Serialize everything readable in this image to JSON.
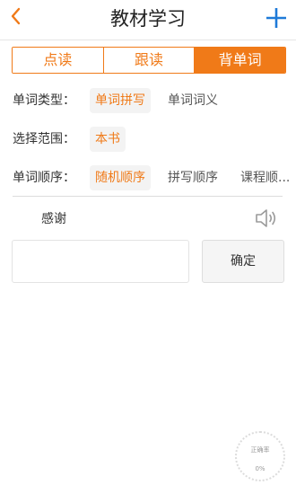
{
  "header": {
    "title": "教材学习",
    "back_icon": "chevron-left-icon",
    "add_icon": "plus-icon",
    "accent_color": "#f07a18",
    "add_color": "#1e7ad8"
  },
  "tabs": [
    {
      "label": "点读",
      "active": false
    },
    {
      "label": "跟读",
      "active": false
    },
    {
      "label": "背单词",
      "active": true
    }
  ],
  "options": {
    "word_type": {
      "label": "单词类型：",
      "choices": [
        "单词拼写",
        "单词词义"
      ],
      "selected": "单词拼写"
    },
    "scope": {
      "label": "选择范围：",
      "choices": [
        "本书"
      ],
      "selected": "本书"
    },
    "order": {
      "label": "单词顺序：",
      "choices": [
        "随机顺序",
        "拼写顺序",
        "课程顺..."
      ],
      "selected": "随机顺序"
    }
  },
  "quiz": {
    "word": "感谢",
    "speaker_icon": "speaker-icon",
    "input_value": "",
    "confirm_label": "确定"
  },
  "accuracy": {
    "label": "正确率",
    "value": "0%"
  }
}
